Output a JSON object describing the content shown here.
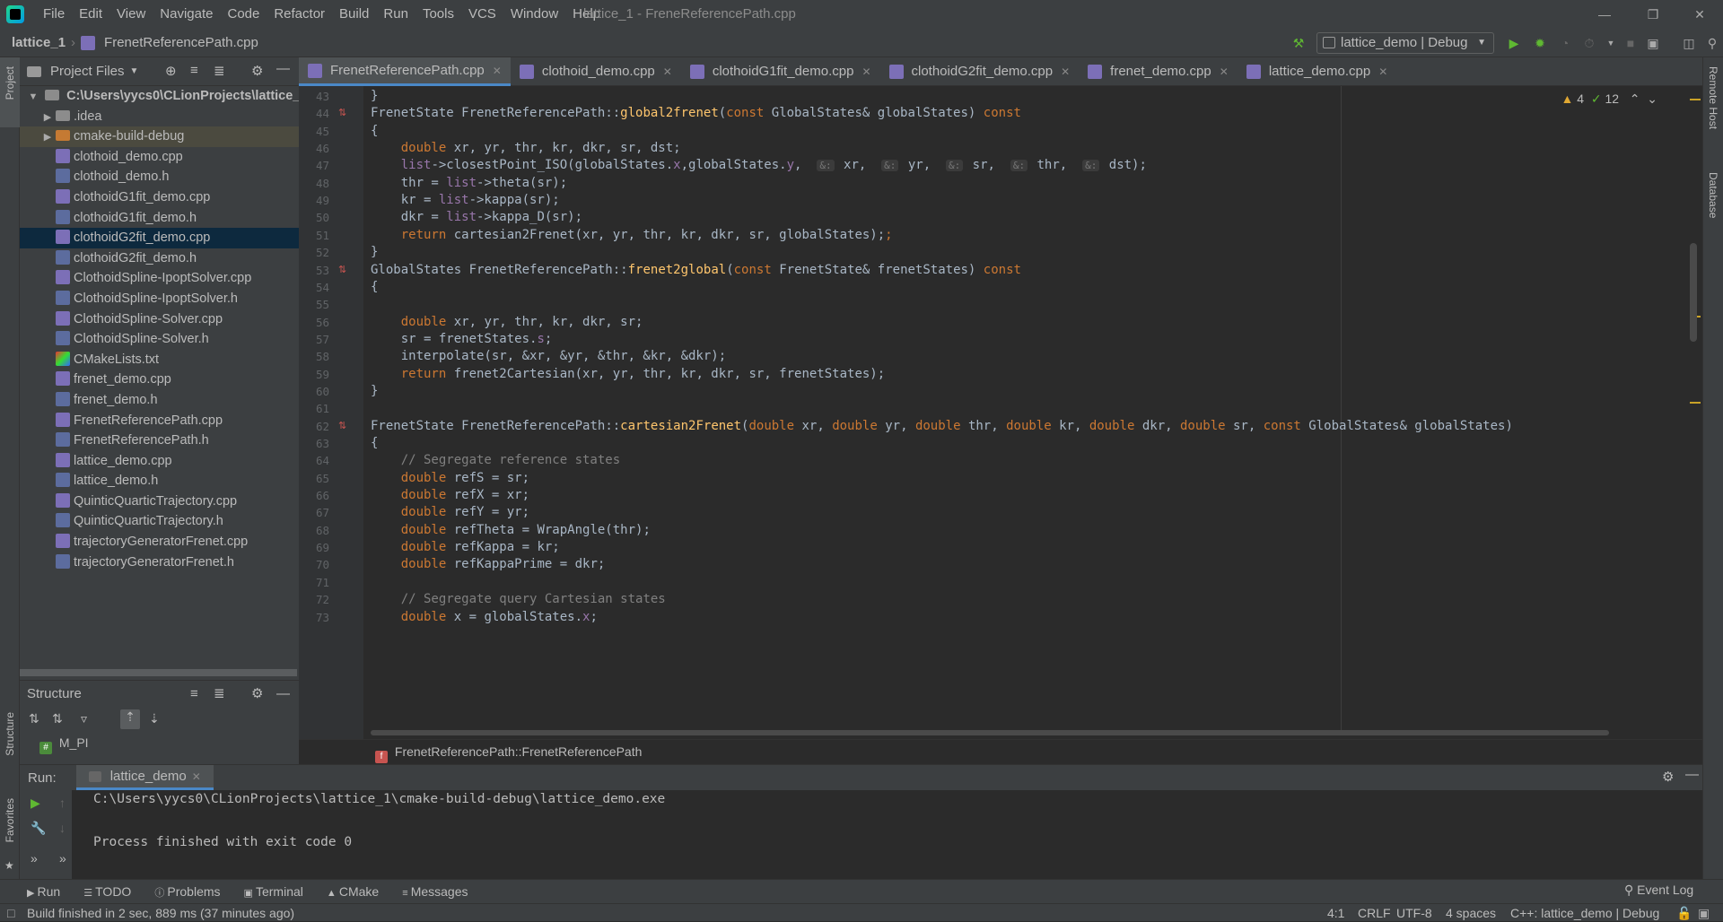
{
  "window": {
    "title": "lattice_1 - FreneReferencePath.cpp",
    "menu": [
      "File",
      "Edit",
      "View",
      "Navigate",
      "Code",
      "Refactor",
      "Build",
      "Run",
      "Tools",
      "VCS",
      "Window",
      "Help"
    ]
  },
  "navbar": {
    "project": "lattice_1",
    "file": "FrenetReferencePath.cpp",
    "run_config": "lattice_demo | Debug"
  },
  "left_tool": {
    "project": "Project",
    "structure": "Structure",
    "favorites": "Favorites"
  },
  "right_tool": {
    "remote_host": "Remote Host",
    "database": "Database"
  },
  "project_panel": {
    "title": "Project Files",
    "root": "C:\\Users\\yycs0\\CLionProjects\\lattice_1",
    "items": [
      {
        "label": ".idea",
        "type": "folder"
      },
      {
        "label": "cmake-build-debug",
        "type": "folder-orange"
      },
      {
        "label": "clothoid_demo.cpp",
        "type": "cpp"
      },
      {
        "label": "clothoid_demo.h",
        "type": "h"
      },
      {
        "label": "clothoidG1fit_demo.cpp",
        "type": "cpp"
      },
      {
        "label": "clothoidG1fit_demo.h",
        "type": "h"
      },
      {
        "label": "clothoidG2fit_demo.cpp",
        "type": "cpp"
      },
      {
        "label": "clothoidG2fit_demo.h",
        "type": "h"
      },
      {
        "label": "ClothoidSpline-IpoptSolver.cpp",
        "type": "cpp"
      },
      {
        "label": "ClothoidSpline-IpoptSolver.h",
        "type": "h"
      },
      {
        "label": "ClothoidSpline-Solver.cpp",
        "type": "cpp"
      },
      {
        "label": "ClothoidSpline-Solver.h",
        "type": "h"
      },
      {
        "label": "CMakeLists.txt",
        "type": "cmake"
      },
      {
        "label": "frenet_demo.cpp",
        "type": "cpp"
      },
      {
        "label": "frenet_demo.h",
        "type": "h"
      },
      {
        "label": "FrenetReferencePath.cpp",
        "type": "cpp"
      },
      {
        "label": "FrenetReferencePath.h",
        "type": "h"
      },
      {
        "label": "lattice_demo.cpp",
        "type": "cpp"
      },
      {
        "label": "lattice_demo.h",
        "type": "h"
      },
      {
        "label": "QuinticQuarticTrajectory.cpp",
        "type": "cpp"
      },
      {
        "label": "QuinticQuarticTrajectory.h",
        "type": "h"
      },
      {
        "label": "trajectoryGeneratorFrenet.cpp",
        "type": "cpp"
      },
      {
        "label": "trajectoryGeneratorFrenet.h",
        "type": "h"
      }
    ]
  },
  "structure_panel": {
    "title": "Structure",
    "item": "M_PI"
  },
  "tabs": [
    "FrenetReferencePath.cpp",
    "clothoid_demo.cpp",
    "clothoidG1fit_demo.cpp",
    "clothoidG2fit_demo.cpp",
    "frenet_demo.cpp",
    "lattice_demo.cpp"
  ],
  "editor": {
    "warnings": "4",
    "checks": "12",
    "lines": [
      {
        "n": "43",
        "html": "}"
      },
      {
        "n": "44",
        "mark": true,
        "html": "<span class='ty'>FrenetState</span> <span class='ty'>FrenetReferencePath</span>::<span class='fn'>global2frenet</span>(<span class='kw'>const</span> GlobalStates& globalStates) <span class='kw'>const</span>"
      },
      {
        "n": "45",
        "html": "{"
      },
      {
        "n": "46",
        "html": "    <span class='kw'>double</span> xr, yr, thr, kr, dkr, sr, dst;"
      },
      {
        "n": "47",
        "html": "    <span class='pu'>list</span>->closestPoint_ISO(globalStates.<span class='pu'>x</span>,globalStates.<span class='pu'>y</span>,  <span class='hint'>&:</span> xr,  <span class='hint'>&:</span> yr,  <span class='hint'>&:</span> sr,  <span class='hint'>&:</span> thr,  <span class='hint'>&:</span> dst);"
      },
      {
        "n": "48",
        "html": "    thr = <span class='pu'>list</span>->theta(sr);"
      },
      {
        "n": "49",
        "html": "    kr = <span class='pu'>list</span>->kappa(sr);"
      },
      {
        "n": "50",
        "html": "    dkr = <span class='pu'>list</span>->kappa_D(sr);"
      },
      {
        "n": "51",
        "html": "    <span class='kw'>return</span> cartesian2Frenet(xr, yr, thr, kr, dkr, sr, globalStates);<span class='kw'>;</span>"
      },
      {
        "n": "52",
        "html": "}"
      },
      {
        "n": "53",
        "mark": true,
        "html": "<span class='ty'>GlobalStates</span> <span class='ty'>FrenetReferencePath</span>::<span class='fn'>frenet2global</span>(<span class='kw'>const</span> FrenetState& frenetStates) <span class='kw'>const</span>"
      },
      {
        "n": "54",
        "html": "{"
      },
      {
        "n": "55",
        "html": ""
      },
      {
        "n": "56",
        "html": "    <span class='kw'>double</span> xr, yr, thr, kr, dkr, sr;"
      },
      {
        "n": "57",
        "html": "    sr = frenetStates.<span class='pu'>s</span>;"
      },
      {
        "n": "58",
        "html": "    interpolate(sr, &xr, &yr, &thr, &kr, &dkr);"
      },
      {
        "n": "59",
        "html": "    <span class='kw'>return</span> frenet2Cartesian(xr, yr, thr, kr, dkr, sr, frenetStates);"
      },
      {
        "n": "60",
        "html": "}"
      },
      {
        "n": "61",
        "html": ""
      },
      {
        "n": "62",
        "mark": true,
        "html": "<span class='ty'>FrenetState</span> <span class='ty'>FrenetReferencePath</span>::<span class='fn'>cartesian2Frenet</span>(<span class='kw'>double</span> xr, <span class='kw'>double</span> yr, <span class='kw'>double</span> thr, <span class='kw'>double</span> kr, <span class='kw'>double</span> dkr, <span class='kw'>double</span> sr, <span class='kw'>const</span> GlobalStates& globalStates)"
      },
      {
        "n": "63",
        "html": "{"
      },
      {
        "n": "64",
        "html": "    <span class='cm2'>// Segregate reference states</span>"
      },
      {
        "n": "65",
        "html": "    <span class='kw'>double</span> refS = sr;"
      },
      {
        "n": "66",
        "html": "    <span class='kw'>double</span> refX = xr;"
      },
      {
        "n": "67",
        "html": "    <span class='kw'>double</span> refY = yr;"
      },
      {
        "n": "68",
        "html": "    <span class='kw'>double</span> refTheta = WrapAngle(thr);"
      },
      {
        "n": "69",
        "html": "    <span class='kw'>double</span> refKappa = kr;"
      },
      {
        "n": "70",
        "html": "    <span class='kw'>double</span> refKappaPrime = dkr;"
      },
      {
        "n": "71",
        "html": ""
      },
      {
        "n": "72",
        "html": "    <span class='cm2'>// Segregate query Cartesian states</span>"
      },
      {
        "n": "73",
        "html": "    <span class='kw'>double</span> x = globalStates.<span class='pu'>x</span>;"
      }
    ]
  },
  "editor_crumb": "FrenetReferencePath::FrenetReferencePath",
  "run": {
    "label": "Run:",
    "tab": "lattice_demo",
    "output": [
      "C:\\Users\\yycs0\\CLionProjects\\lattice_1\\cmake-build-debug\\lattice_demo.exe",
      "",
      "Process finished with exit code 0"
    ]
  },
  "bottom_tools": [
    "Run",
    "TODO",
    "Problems",
    "Terminal",
    "CMake",
    "Messages"
  ],
  "event_log": "Event Log",
  "status": {
    "message": "Build finished in 2 sec, 889 ms (37 minutes ago)",
    "position": "4:1",
    "line_sep": "CRLF",
    "encoding": "UTF-8",
    "indent": "4 spaces",
    "context": "C++: lattice_demo | Debug"
  }
}
